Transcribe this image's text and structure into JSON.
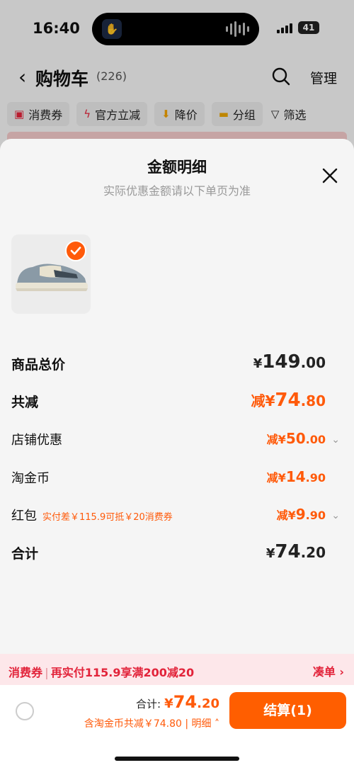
{
  "status_bar": {
    "time": "16:40",
    "battery": "41"
  },
  "nav": {
    "back_icon": "chevron-left-icon",
    "title": "购物车",
    "count": "(226)",
    "search_icon": "search-icon",
    "manage": "管理"
  },
  "filters": [
    {
      "label": "消费券",
      "icon": "coupon-icon"
    },
    {
      "label": "官方立减",
      "icon": "lightning-icon"
    },
    {
      "label": "降价",
      "icon": "arrow-down-icon"
    },
    {
      "label": "分组",
      "icon": "folder-icon"
    },
    {
      "label": "筛选",
      "icon": "filter-icon"
    }
  ],
  "sheet": {
    "title": "金额明细",
    "subtitle": "实际优惠金额请以下单页为准",
    "close_icon": "close-icon"
  },
  "rows": {
    "total_price": {
      "label": "商品总价",
      "yen": "¥",
      "int": "149",
      "dec": ".00"
    },
    "total_discount": {
      "label": "共减",
      "prefix": "减",
      "yen": "¥",
      "int": "74",
      "dec": ".80"
    },
    "store_discount": {
      "label": "店铺优惠",
      "prefix": "减",
      "yen": "¥",
      "int": "50",
      "dec": ".00"
    },
    "taojinbi": {
      "label": "淘金币",
      "prefix": "减",
      "yen": "¥",
      "int": "14",
      "dec": ".90"
    },
    "red_packet": {
      "label": "红包",
      "note": "实付差￥115.9可抵￥20消费券",
      "prefix": "减",
      "yen": "¥",
      "int": "9",
      "dec": ".90"
    },
    "sum": {
      "label": "合计",
      "yen": "¥",
      "int": "74",
      "dec": ".20"
    }
  },
  "coupon_banner": {
    "tag": "消费券",
    "text": "再实付115.9享满200减20",
    "link": "凑单 ›"
  },
  "bottom": {
    "total_label": "合计:",
    "yen": "¥",
    "int": "74",
    "dec": ".20",
    "saved": "含淘金币共减￥74.80 | 明细",
    "checkout": "结算(1)"
  },
  "colors": {
    "accent": "#ff5a0a",
    "coupon_red": "#e2233a",
    "checkout_bg": "#ff5e00"
  }
}
